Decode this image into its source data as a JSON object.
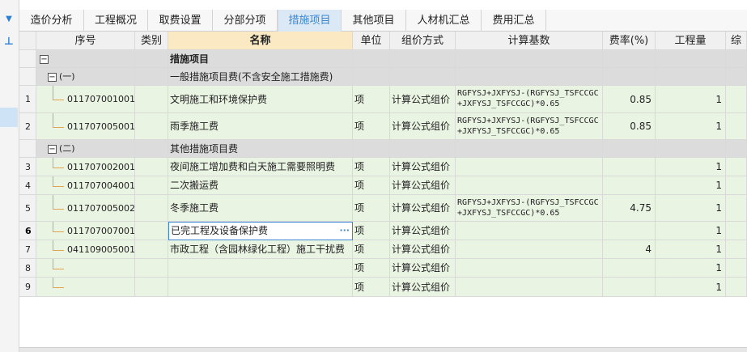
{
  "tabs": [
    {
      "label": "造价分析",
      "active": false
    },
    {
      "label": "工程概况",
      "active": false
    },
    {
      "label": "取费设置",
      "active": false
    },
    {
      "label": "分部分项",
      "active": false
    },
    {
      "label": "措施项目",
      "active": true
    },
    {
      "label": "其他项目",
      "active": false
    },
    {
      "label": "人材机汇总",
      "active": false
    },
    {
      "label": "费用汇总",
      "active": false
    }
  ],
  "columns": [
    "序号",
    "类别",
    "名称",
    "单位",
    "组价方式",
    "计算基数",
    "费率(%)",
    "工程量",
    "综"
  ],
  "rows": [
    {
      "kind": "root",
      "idx": "",
      "code": "",
      "name": "措施项目",
      "unit": "",
      "method": "",
      "base": "",
      "rate": "",
      "qty": "",
      "expander": "−"
    },
    {
      "kind": "group",
      "idx": "",
      "code": "(一)",
      "name": "一般措施项目费(不含安全施工措施费)",
      "unit": "",
      "method": "",
      "base": "",
      "rate": "",
      "qty": "",
      "expander": "−"
    },
    {
      "kind": "item",
      "idx": "1",
      "code": "011707001001",
      "name": "文明施工和环境保护费",
      "unit": "项",
      "method": "计算公式组价",
      "base": "RGFYSJ+JXFYSJ-(RGFYSJ_TSFCCGC\n+JXFYSJ_TSFCCGC)*0.65",
      "rate": "0.85",
      "qty": "1"
    },
    {
      "kind": "item",
      "idx": "2",
      "code": "011707005001",
      "name": "雨季施工费",
      "unit": "项",
      "method": "计算公式组价",
      "base": "RGFYSJ+JXFYSJ-(RGFYSJ_TSFCCGC\n+JXFYSJ_TSFCCGC)*0.65",
      "rate": "0.85",
      "qty": "1"
    },
    {
      "kind": "group",
      "idx": "",
      "code": "(二)",
      "name": "其他措施项目费",
      "unit": "",
      "method": "",
      "base": "",
      "rate": "",
      "qty": "",
      "expander": "−"
    },
    {
      "kind": "item",
      "idx": "3",
      "code": "011707002001",
      "name": "夜间施工增加费和白天施工需要照明费",
      "unit": "项",
      "method": "计算公式组价",
      "base": "",
      "rate": "",
      "qty": "1"
    },
    {
      "kind": "item",
      "idx": "4",
      "code": "011707004001",
      "name": "二次搬运费",
      "unit": "项",
      "method": "计算公式组价",
      "base": "",
      "rate": "",
      "qty": "1"
    },
    {
      "kind": "item",
      "idx": "5",
      "code": "011707005002",
      "name": "冬季施工费",
      "unit": "项",
      "method": "计算公式组价",
      "base": "RGFYSJ+JXFYSJ-(RGFYSJ_TSFCCGC\n+JXFYSJ_TSFCCGC)*0.65",
      "rate": "4.75",
      "qty": "1"
    },
    {
      "kind": "item",
      "idx": "6",
      "code": "011707007001",
      "name": "已完工程及设备保护费",
      "unit": "项",
      "method": "计算公式组价",
      "base": "",
      "rate": "",
      "qty": "1",
      "current": true
    },
    {
      "kind": "item",
      "idx": "7",
      "code": "041109005001",
      "name": "市政工程（含园林绿化工程）施工干扰费",
      "unit": "项",
      "method": "计算公式组价",
      "base": "",
      "rate": "4",
      "qty": "1"
    },
    {
      "kind": "item",
      "idx": "8",
      "code": "",
      "name": "",
      "unit": "项",
      "method": "计算公式组价",
      "base": "",
      "rate": "",
      "qty": "1"
    },
    {
      "kind": "item",
      "idx": "9",
      "code": "",
      "name": "",
      "unit": "项",
      "method": "计算公式组价",
      "base": "",
      "rate": "",
      "qty": "1"
    }
  ],
  "icons": {
    "dropdown": "dropdown-arrow-icon",
    "pin": "pin-icon",
    "more": "ellipsis-icon"
  },
  "colors": {
    "accent": "#3b86d0",
    "header_active": "#fbe9c3",
    "group_bg": "#dcdcdc",
    "item_bg": "#eaf4e3",
    "tree_line": "#e0a64d"
  }
}
